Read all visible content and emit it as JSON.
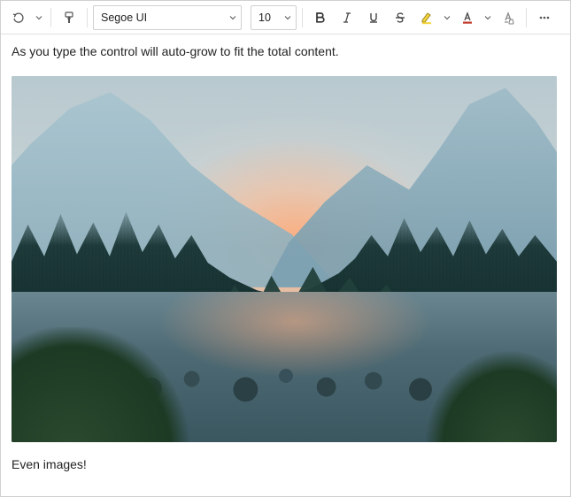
{
  "toolbar": {
    "font_family": "Segoe UI",
    "font_size": "10",
    "icons": {
      "undo": "undo-icon",
      "undo_split": "chevron-down-icon",
      "format_painter": "format-painter-icon",
      "bold": "bold-icon",
      "italic": "italic-icon",
      "underline": "underline-icon",
      "strike": "strikethrough-icon",
      "highlight": "highlight-icon",
      "highlight_split": "chevron-down-icon",
      "font_color": "font-color-icon",
      "font_color_split": "chevron-down-icon",
      "clear_format": "clear-formatting-icon",
      "overflow": "more-icon"
    },
    "highlight_swatch": "#f3d33a",
    "font_color_swatch": "#c0392b"
  },
  "document": {
    "line1": "As you type the control will auto-grow to fit the total content.",
    "image_alt": "Misty mountain valley with river, pine forest and orange sunrise glow",
    "line2": "Even images!"
  }
}
